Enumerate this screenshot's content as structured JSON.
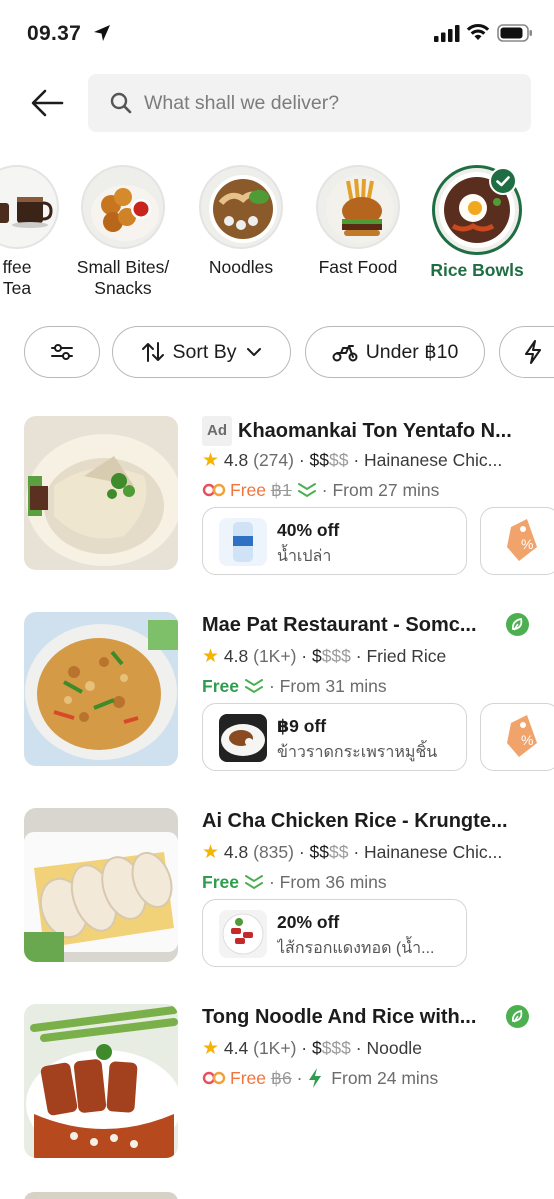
{
  "status_bar": {
    "time": "09.37"
  },
  "search": {
    "placeholder": "What shall we deliver?"
  },
  "categories": [
    {
      "label_line1": "ffee",
      "label_line2": "Tea",
      "icon": "coffee-icon"
    },
    {
      "label_line1": "Small Bites/",
      "label_line2": "Snacks",
      "icon": "snacks-icon"
    },
    {
      "label_line1": "Noodles",
      "label_line2": "",
      "icon": "noodles-icon"
    },
    {
      "label_line1": "Fast Food",
      "label_line2": "",
      "icon": "burger-icon"
    },
    {
      "label_line1": "Rice Bowls",
      "label_line2": "",
      "icon": "rice-bowl-icon",
      "selected": true
    }
  ],
  "filters": {
    "sort_label": "Sort By",
    "under_label": "Under ฿10"
  },
  "restaurants": [
    {
      "ad": "Ad",
      "name": "Khaomankai Ton Yentafo N...",
      "rating": "4.8",
      "reviews": "(274)",
      "price_dark": "$$",
      "price_grey": "$$",
      "cuisine": "Hainanese Chic...",
      "free": "Free",
      "old_fee": "฿1",
      "eta": "From 27 mins",
      "promo_title": "40% off",
      "promo_item": "น้ำเปล่า"
    },
    {
      "name": "Mae Pat Restaurant - Somc...",
      "rating": "4.8",
      "reviews": "(1K+)",
      "price_dark": "$",
      "price_grey": "$$$",
      "cuisine": "Fried Rice",
      "free": "Free",
      "eta": "From 31 mins",
      "promo_title": "฿9 off",
      "promo_item": "ข้าวราดกระเพราหมูชิ้น"
    },
    {
      "name": "Ai Cha Chicken Rice - Krungte...",
      "rating": "4.8",
      "reviews": "(835)",
      "price_dark": "$$",
      "price_grey": "$$",
      "cuisine": "Hainanese Chic...",
      "free": "Free",
      "eta": "From 36 mins",
      "promo_title": "20% off",
      "promo_item": "ไส้กรอกแดงทอด (น้ำ..."
    },
    {
      "name": "Tong Noodle And Rice with...",
      "rating": "4.4",
      "reviews": "(1K+)",
      "price_dark": "$",
      "price_grey": "$$$",
      "cuisine": "Noodle",
      "free": "Free",
      "old_fee": "฿6",
      "eta": "From 24 mins"
    }
  ],
  "colors": {
    "brand_green": "#1f6e43",
    "free_green": "#2e9e4e",
    "free_orange": "#f2743a",
    "star": "#f4b400"
  }
}
